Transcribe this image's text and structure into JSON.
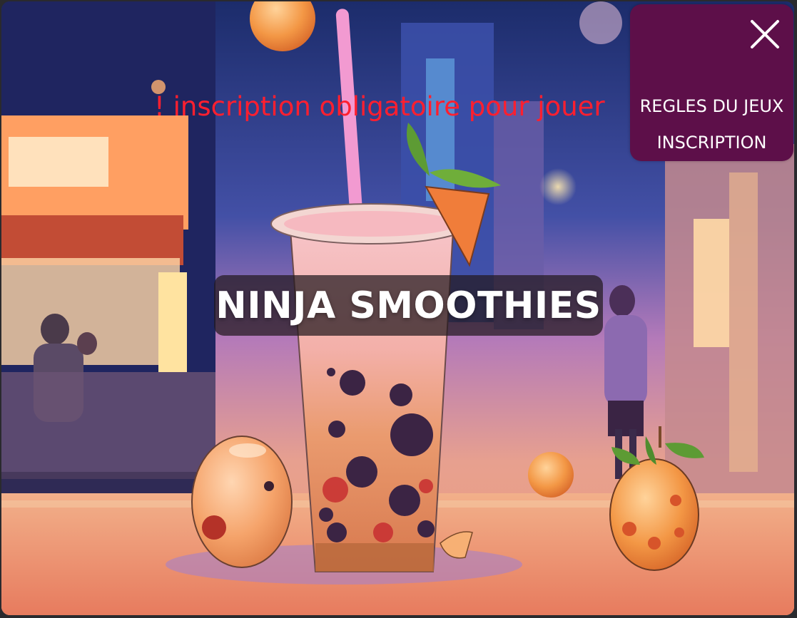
{
  "game": {
    "title": "NINJA SMOOTHIES",
    "warning": "! inscription obligatoire pour jouer"
  },
  "menu": {
    "items": [
      {
        "label": "REGLES DU JEUX"
      },
      {
        "label": "INSCRIPTION"
      }
    ],
    "close_icon": "close-icon"
  },
  "colors": {
    "menu_bg": "#5d0f49",
    "warning_text": "#ff1f2f",
    "title_bg": "rgba(35,25,30,0.72)",
    "title_text": "#ffffff"
  }
}
